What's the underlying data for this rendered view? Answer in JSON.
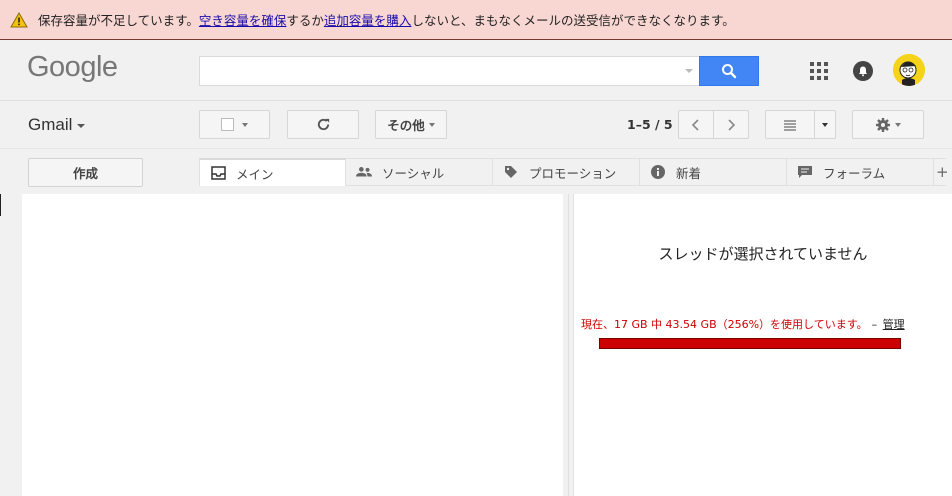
{
  "banner": {
    "text_before": "保存容量が不足しています。",
    "link1": "空き容量を確保",
    "text_middle": "するか",
    "link2": "追加容量を購入",
    "text_after": "しないと、まもなくメールの送受信ができなくなります。"
  },
  "header": {
    "logo": "Google",
    "search": {
      "value": "",
      "placeholder": ""
    }
  },
  "toolbar": {
    "app_label": "Gmail",
    "more_label": "その他",
    "pager": "1–5 / 5"
  },
  "sidebar": {
    "compose_label": "作成"
  },
  "tabs": [
    {
      "label": "メイン",
      "icon": "inbox-icon"
    },
    {
      "label": "ソーシャル",
      "icon": "people-icon"
    },
    {
      "label": "プロモーション",
      "icon": "tag-icon"
    },
    {
      "label": "新着",
      "icon": "info-icon"
    },
    {
      "label": "フォーラム",
      "icon": "chat-icon"
    }
  ],
  "reading_pane": {
    "empty_text": "スレッドが選択されていません",
    "storage_text": "現在、17 GB 中 43.54 GB（256%）を使用しています。",
    "storage_dash": "–",
    "manage_link": "管理",
    "usage_percent": 256
  },
  "colors": {
    "banner_bg": "#f8d7d3",
    "search_blue": "#4285f4",
    "storage_red": "#cc0000"
  }
}
